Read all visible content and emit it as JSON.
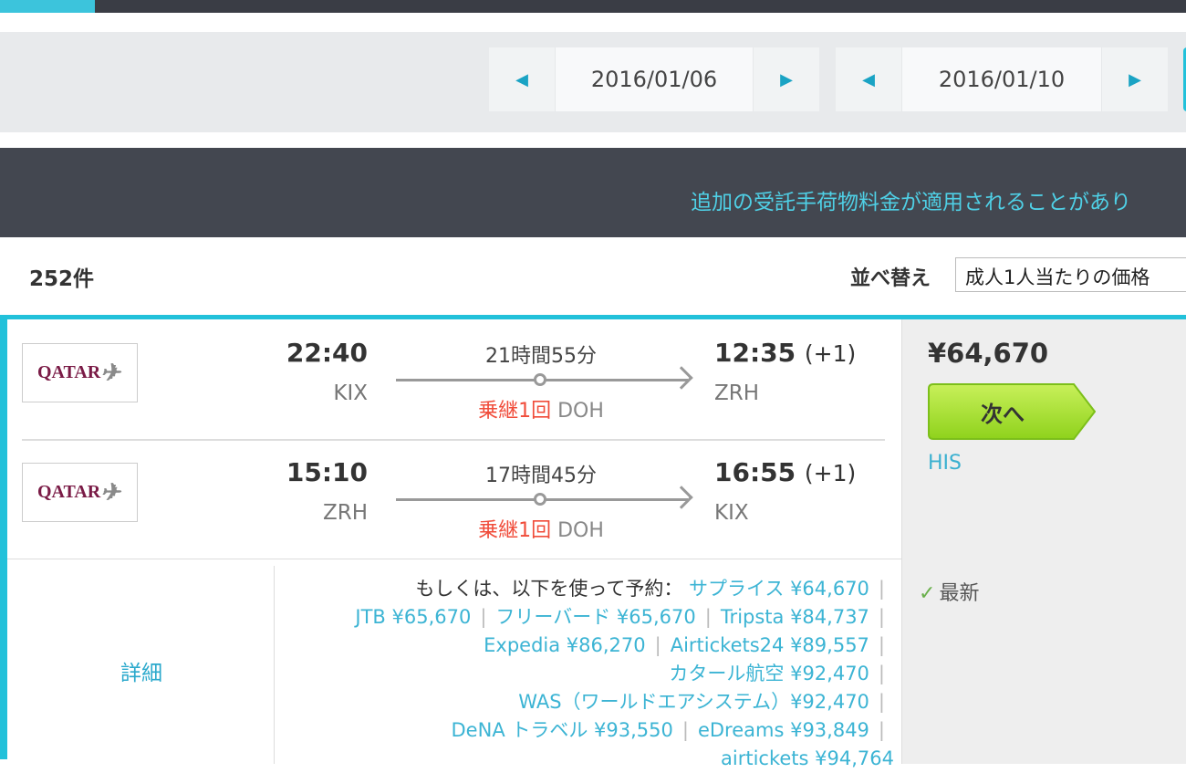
{
  "dates": {
    "depart": "2016/01/06",
    "return": "2016/01/10"
  },
  "notice": "追加の受託手荷物料金が適用されることがあり",
  "results": {
    "count": "252件",
    "sort_label": "並べ替え",
    "sort_value": "成人1人当たりの価格"
  },
  "flight": {
    "legs": [
      {
        "airline": "QATAR",
        "dep_time": "22:40",
        "dep_airport": "KIX",
        "duration": "21時間55分",
        "stops": "乗継1回",
        "via": "DOH",
        "arr_time": "12:35",
        "arr_offset": "(+1)",
        "arr_airport": "ZRH"
      },
      {
        "airline": "QATAR",
        "dep_time": "15:10",
        "dep_airport": "ZRH",
        "duration": "17時間45分",
        "stops": "乗継1回",
        "via": "DOH",
        "arr_time": "16:55",
        "arr_offset": "(+1)",
        "arr_airport": "KIX"
      }
    ],
    "price": "¥64,670",
    "next_label": "次へ",
    "provider": "HIS",
    "latest_label": "最新",
    "detail_label": "詳細",
    "others_prefix": "もしくは、以下を使って予約：",
    "others": [
      "サプライス ¥64,670",
      "JTB ¥65,670",
      "フリーバード ¥65,670",
      "Tripsta ¥84,737",
      "Expedia ¥86,270",
      "Airtickets24 ¥89,557",
      "カタール航空 ¥92,470",
      "WAS（ワールドエアシステム）¥92,470",
      "DeNA トラベル ¥93,550",
      "eDreams ¥93,849",
      "airtickets ¥94,764"
    ]
  }
}
